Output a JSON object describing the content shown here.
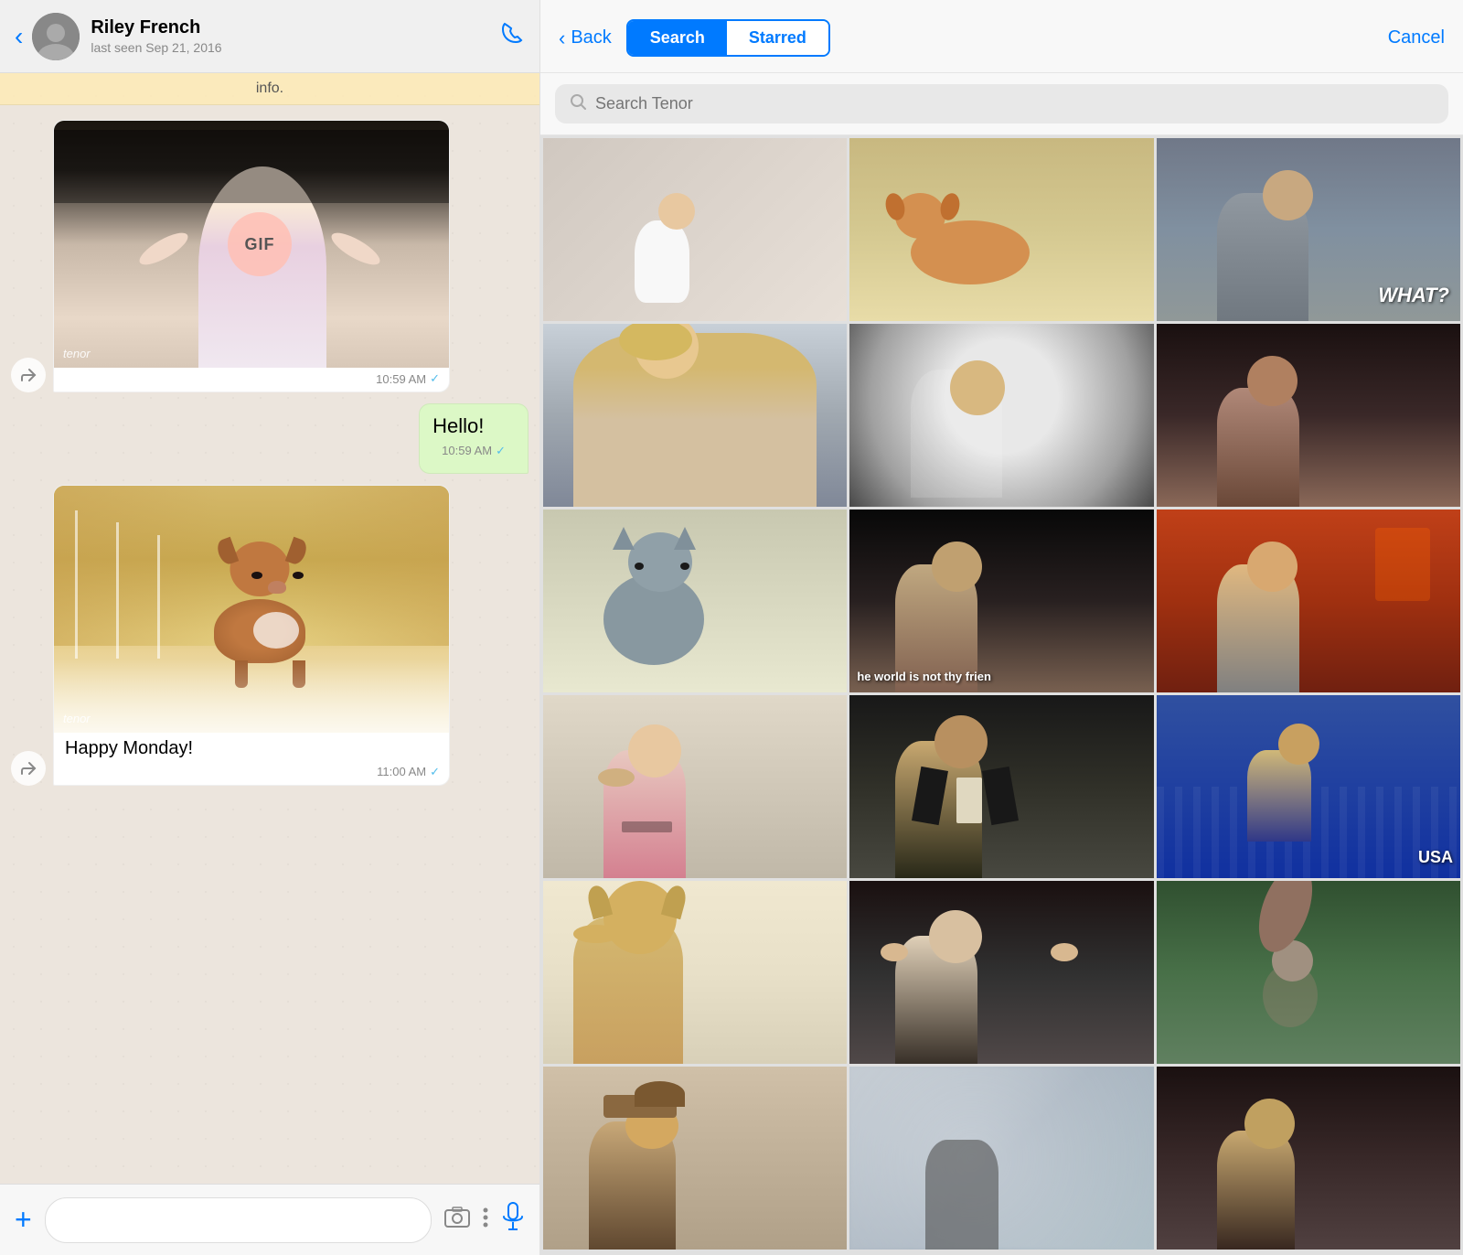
{
  "chat": {
    "back_label": "‹",
    "contact_name": "Riley French",
    "contact_status": "last seen Sep 21, 2016",
    "info_bar": "info.",
    "message1_attribution": "tenor",
    "message1_time": "10:59 AM",
    "message1_checkmark": "✓",
    "message1_gif_label": "GIF",
    "message2_text": "Hello!",
    "message2_time": "10:59 AM",
    "message2_checkmark": "✓",
    "message3_attribution": "tenor",
    "message3_time": "11:00 AM",
    "message3_checkmark": "✓",
    "message3_text": "Happy Monday!",
    "input_placeholder": ""
  },
  "gif_picker": {
    "back_label": "Back",
    "tab_search": "Search",
    "tab_starred": "Starred",
    "cancel_label": "Cancel",
    "search_placeholder": "Search Tenor",
    "cells": [
      {
        "id": 1,
        "class": "gc-1"
      },
      {
        "id": 2,
        "class": "gc-2"
      },
      {
        "id": 3,
        "class": "gc-3",
        "overlay_text": "WHAT?"
      },
      {
        "id": 4,
        "class": "gc-4"
      },
      {
        "id": 5,
        "class": "gc-5"
      },
      {
        "id": 6,
        "class": "gc-6"
      },
      {
        "id": 7,
        "class": "gc-7"
      },
      {
        "id": 8,
        "class": "gc-8",
        "caption": "he world is not thy frien"
      },
      {
        "id": 9,
        "class": "gc-9"
      },
      {
        "id": 10,
        "class": "gc-10"
      },
      {
        "id": 11,
        "class": "gc-11"
      },
      {
        "id": 12,
        "class": "gc-12",
        "caption": "USA"
      },
      {
        "id": 13,
        "class": "gc-13"
      },
      {
        "id": 14,
        "class": "gc-14"
      },
      {
        "id": 15,
        "class": "gc-15"
      },
      {
        "id": 16,
        "class": "gc-16"
      },
      {
        "id": 17,
        "class": "gc-17"
      },
      {
        "id": 18,
        "class": "gc-18"
      },
      {
        "id": 19,
        "class": "gc-19"
      },
      {
        "id": 20,
        "class": "gc-20"
      },
      {
        "id": 21,
        "class": "gc-21"
      }
    ]
  }
}
